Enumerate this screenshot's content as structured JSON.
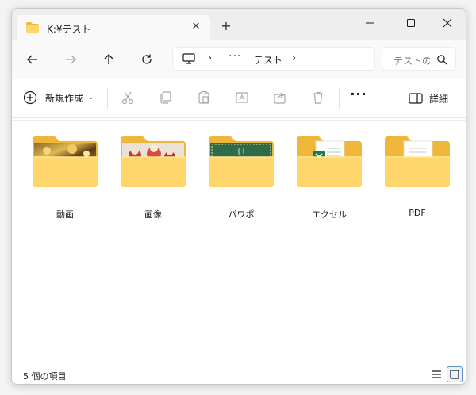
{
  "window": {
    "tab_title": "K:¥テスト",
    "tab_close_glyph": "✕",
    "new_tab_glyph": "+",
    "controls": [
      "minimize-icon",
      "maximize-icon",
      "close-icon"
    ]
  },
  "nav": {
    "back_icon": "arrow-left-icon",
    "forward_icon": "arrow-right-icon",
    "up_icon": "arrow-up-icon",
    "refresh_icon": "refresh-icon",
    "address": {
      "root_icon": "this-pc-icon",
      "separator": "›",
      "overflow": "···",
      "crumbs": [
        "テスト"
      ]
    },
    "search": {
      "placeholder": "テストの検索",
      "icon": "search-icon"
    }
  },
  "commandbar": {
    "new_label": "新規作成",
    "new_chevron": "⌄",
    "more_glyph": "···",
    "details_label": "詳細",
    "icons": [
      "cut-icon",
      "copy-icon",
      "paste-icon",
      "rename-icon",
      "share-icon",
      "delete-icon"
    ]
  },
  "folders": [
    {
      "name": "動画",
      "thumb": "photo-golden"
    },
    {
      "name": "画像",
      "thumb": "photo-figurines"
    },
    {
      "name": "パワポ",
      "thumb": "slide-green"
    },
    {
      "name": "エクセル",
      "thumb": "excel-doc"
    },
    {
      "name": "PDF",
      "thumb": "pdf-doc"
    }
  ],
  "status": {
    "item_count": "5 個の項目"
  },
  "colors": {
    "folder_back": "#f0b63a",
    "folder_front": "#ffd66b",
    "excel_green": "#1d7a45",
    "pdf_red": "#d8282b",
    "accent": "#5b8fc9"
  }
}
